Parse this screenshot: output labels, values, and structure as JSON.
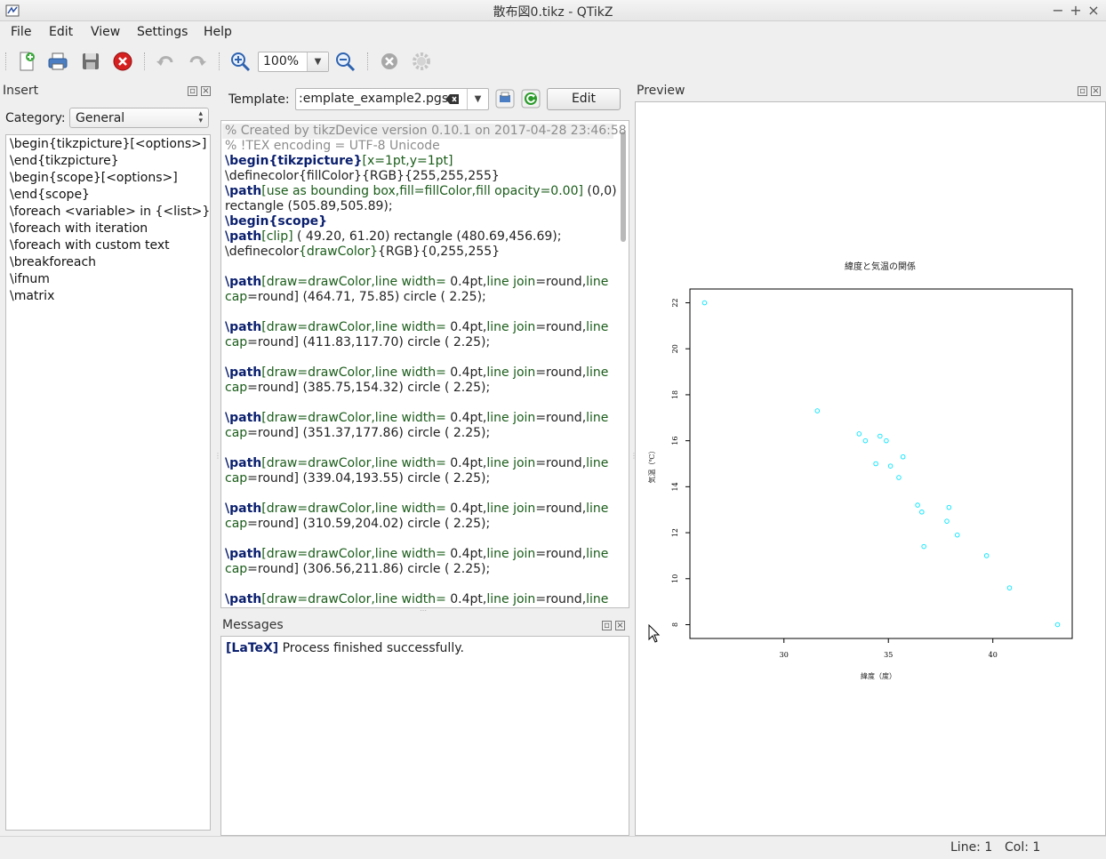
{
  "window": {
    "title": "散布図0.tikz - QTikZ",
    "min": "−",
    "max": "+",
    "close": "×"
  },
  "menu": [
    "File",
    "Edit",
    "View",
    "Settings",
    "Help"
  ],
  "toolbar": {
    "zoom": "100%"
  },
  "insert": {
    "title": "Insert",
    "category_label": "Category:",
    "category_value": "General",
    "items": [
      "\\begin{tikzpicture}[<options>]",
      "\\end{tikzpicture}",
      "\\begin{scope}[<options>]",
      "\\end{scope}",
      "\\foreach <variable> in {<list>}",
      "\\foreach with iteration",
      "\\foreach with custom text",
      "\\breakforeach",
      "\\ifnum",
      "\\matrix"
    ]
  },
  "template": {
    "label": "Template:",
    "value": ":emplate_example2.pgs",
    "edit_label": "Edit"
  },
  "editor": {
    "lines": [
      [
        [
          "c",
          "% Created by tikzDevice version 0.10.1 on 2017-04-28 23:46:58"
        ]
      ],
      [
        [
          "c",
          "% !TEX encoding = UTF-8 Unicode"
        ]
      ],
      [
        [
          "k",
          "\\begin{tikzpicture}"
        ],
        [
          "o",
          "[x=1pt,y=1pt]"
        ]
      ],
      [
        [
          "n",
          "\\definecolor{fillColor}{RGB}{255,255,255}"
        ]
      ],
      [
        [
          "k",
          "\\path"
        ],
        [
          "o",
          "[use as bounding box,fill=fillColor,fill opacity=0.00]"
        ],
        [
          "n",
          " (0,0)"
        ]
      ],
      [
        [
          "n",
          "rectangle (505.89,505.89);"
        ]
      ],
      [
        [
          "k",
          "\\begin{scope}"
        ]
      ],
      [
        [
          "k",
          "\\path"
        ],
        [
          "o",
          "[clip]"
        ],
        [
          "n",
          " ( 49.20, 61.20) rectangle (480.69,456.69);"
        ]
      ],
      [
        [
          "n",
          "\\definecolor"
        ],
        [
          "o",
          "{drawColor}"
        ],
        [
          "n",
          "{RGB}{0,255,255}"
        ]
      ],
      [],
      [
        [
          "k",
          "\\path"
        ],
        [
          "o",
          "[draw=drawColor,line width="
        ],
        [
          "n",
          " 0.4pt,"
        ],
        [
          "o",
          "line join"
        ],
        [
          "n",
          "=round,"
        ],
        [
          "o",
          "line"
        ]
      ],
      [
        [
          "o",
          "cap"
        ],
        [
          "n",
          "=round] (464.71, 75.85) circle (  2.25);"
        ]
      ],
      [],
      [
        [
          "k",
          "\\path"
        ],
        [
          "o",
          "[draw=drawColor,line width="
        ],
        [
          "n",
          " 0.4pt,"
        ],
        [
          "o",
          "line join"
        ],
        [
          "n",
          "=round,"
        ],
        [
          "o",
          "line"
        ]
      ],
      [
        [
          "o",
          "cap"
        ],
        [
          "n",
          "=round] (411.83,117.70) circle (  2.25);"
        ]
      ],
      [],
      [
        [
          "k",
          "\\path"
        ],
        [
          "o",
          "[draw=drawColor,line width="
        ],
        [
          "n",
          " 0.4pt,"
        ],
        [
          "o",
          "line join"
        ],
        [
          "n",
          "=round,"
        ],
        [
          "o",
          "line"
        ]
      ],
      [
        [
          "o",
          "cap"
        ],
        [
          "n",
          "=round] (385.75,154.32) circle (  2.25);"
        ]
      ],
      [],
      [
        [
          "k",
          "\\path"
        ],
        [
          "o",
          "[draw=drawColor,line width="
        ],
        [
          "n",
          " 0.4pt,"
        ],
        [
          "o",
          "line join"
        ],
        [
          "n",
          "=round,"
        ],
        [
          "o",
          "line"
        ]
      ],
      [
        [
          "o",
          "cap"
        ],
        [
          "n",
          "=round] (351.37,177.86) circle (  2.25);"
        ]
      ],
      [],
      [
        [
          "k",
          "\\path"
        ],
        [
          "o",
          "[draw=drawColor,line width="
        ],
        [
          "n",
          " 0.4pt,"
        ],
        [
          "o",
          "line join"
        ],
        [
          "n",
          "=round,"
        ],
        [
          "o",
          "line"
        ]
      ],
      [
        [
          "o",
          "cap"
        ],
        [
          "n",
          "=round] (339.04,193.55) circle (  2.25);"
        ]
      ],
      [],
      [
        [
          "k",
          "\\path"
        ],
        [
          "o",
          "[draw=drawColor,line width="
        ],
        [
          "n",
          " 0.4pt,"
        ],
        [
          "o",
          "line join"
        ],
        [
          "n",
          "=round,"
        ],
        [
          "o",
          "line"
        ]
      ],
      [
        [
          "o",
          "cap"
        ],
        [
          "n",
          "=round] (310.59,204.02) circle (  2.25);"
        ]
      ],
      [],
      [
        [
          "k",
          "\\path"
        ],
        [
          "o",
          "[draw=drawColor,line width="
        ],
        [
          "n",
          " 0.4pt,"
        ],
        [
          "o",
          "line join"
        ],
        [
          "n",
          "=round,"
        ],
        [
          "o",
          "line"
        ]
      ],
      [
        [
          "o",
          "cap"
        ],
        [
          "n",
          "=round] (306.56,211.86) circle (  2.25);"
        ]
      ],
      [],
      [
        [
          "k",
          "\\path"
        ],
        [
          "o",
          "[draw=drawColor,line width="
        ],
        [
          "n",
          " 0.4pt,"
        ],
        [
          "o",
          "line join"
        ],
        [
          "n",
          "=round,"
        ],
        [
          "o",
          "line"
        ]
      ]
    ]
  },
  "messages": {
    "title": "Messages",
    "tag": "[LaTeX]",
    "text": " Process finished successfully."
  },
  "preview": {
    "title": "Preview"
  },
  "status": {
    "line": "Line: 1",
    "col": "Col: 1"
  },
  "colors": {
    "point": "#00e5ff",
    "keyword": "#0a1f6e",
    "option": "#1a5c1a",
    "comment": "#8c8c8c"
  },
  "chart_data": {
    "type": "scatter",
    "title": "緯度と気温の関係",
    "xlabel": "緯度（度）",
    "ylabel": "気温（℃）",
    "xlim": [
      25.5,
      43.8
    ],
    "ylim": [
      7.4,
      22.6
    ],
    "xticks": [
      30,
      35,
      40
    ],
    "yticks": [
      8,
      10,
      12,
      14,
      16,
      18,
      20,
      22
    ],
    "points": [
      [
        26.2,
        22.0
      ],
      [
        31.6,
        17.3
      ],
      [
        33.6,
        16.3
      ],
      [
        34.6,
        16.2
      ],
      [
        34.9,
        16.0
      ],
      [
        33.9,
        16.0
      ],
      [
        35.7,
        15.3
      ],
      [
        34.4,
        15.0
      ],
      [
        35.1,
        14.9
      ],
      [
        35.5,
        14.4
      ],
      [
        36.4,
        13.2
      ],
      [
        36.6,
        12.9
      ],
      [
        37.9,
        13.1
      ],
      [
        37.8,
        12.5
      ],
      [
        38.3,
        11.9
      ],
      [
        36.7,
        11.4
      ],
      [
        39.7,
        11.0
      ],
      [
        40.8,
        9.6
      ],
      [
        43.1,
        8.0
      ]
    ]
  }
}
